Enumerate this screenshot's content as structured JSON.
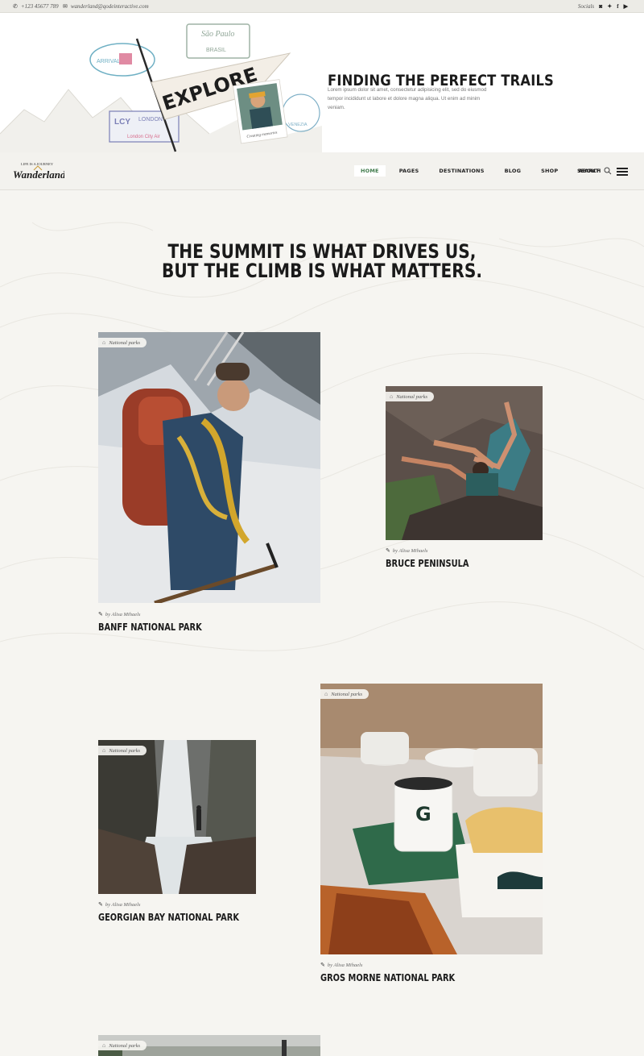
{
  "topbar": {
    "phone": "+123 45677 789",
    "email": "wanderland@qodeinteractive.com",
    "socials_label": "Socials",
    "social_icons": [
      "instagram-icon",
      "twitter-icon",
      "facebook-icon",
      "youtube-icon"
    ]
  },
  "hero": {
    "title": "FINDING THE PERFECT TRAILS",
    "text": "Lorem ipsum dolor sit amet, consectetur adipisicing elit, sed do eiusmod tempor incididunt ut labore et dolore magna aliqua. Ut enim ad minim veniam.",
    "pennant_word": "EXPLORE",
    "stamp_top": "São Paulo",
    "stamp_top_sub": "BRASIL",
    "stamp_left": "ARRIVAL",
    "stamp_lcy": "LCY",
    "stamp_london": "LONDON",
    "stamp_airport": "London City Air",
    "stamp_venezia": "VENEZIA",
    "photo_caption": "Creating memories"
  },
  "nav": {
    "logo_top": "LIFE IS A JOURNEY",
    "logo_text": "Wanderland",
    "items": [
      "HOME",
      "PAGES",
      "DESTINATIONS",
      "BLOG",
      "SHOP",
      "ABOUT"
    ],
    "search_label": "SEARCH"
  },
  "quote": {
    "line1": "THE SUMMIT IS WHAT DRIVES US,",
    "line2": "BUT THE CLIMB IS WHAT MATTERS."
  },
  "posts": [
    {
      "category": "National parks",
      "author": "by Alisa Mihaels",
      "title": "BANFF NATIONAL PARK"
    },
    {
      "category": "National parks",
      "author": "by Alisa Mihaels",
      "title": "BRUCE PENINSULA"
    },
    {
      "category": "National parks",
      "author": "by Alisa Mihaels",
      "title": "GEORGIAN BAY NATIONAL PARK"
    },
    {
      "category": "National parks",
      "author": "by Alisa Mihaels",
      "title": "GROS MORNE NATIONAL PARK"
    },
    {
      "category": "National parks"
    }
  ],
  "colors": {
    "accent_green": "#3f7a4a",
    "text_dark": "#1b1b1b",
    "page_bg": "#f6f5f1"
  }
}
